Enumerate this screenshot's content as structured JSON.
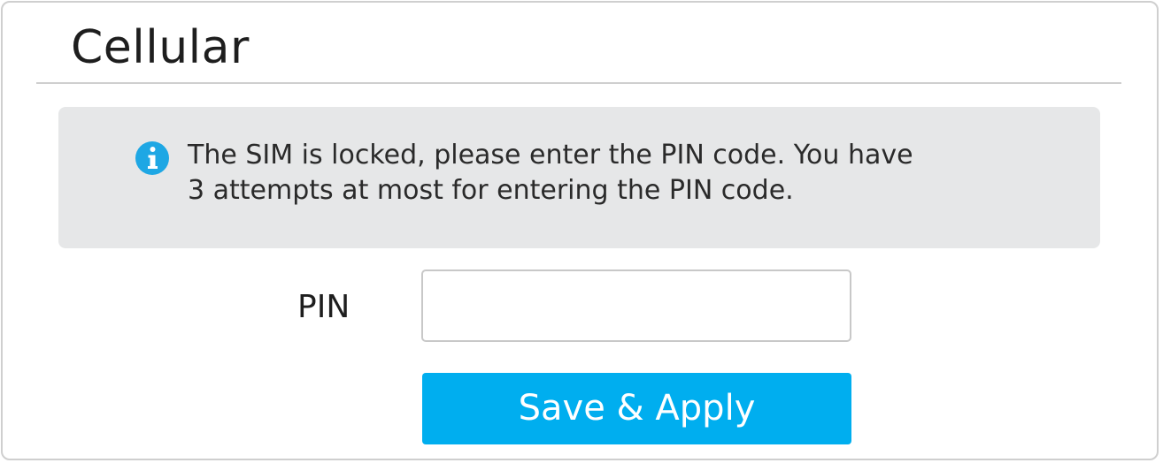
{
  "section": {
    "title": "Cellular"
  },
  "notice": {
    "icon": "info-icon",
    "icon_color": "#1ea7e4",
    "lines": [
      "The SIM is locked, please enter the PIN code. You have",
      "3 attempts at most for entering the PIN code."
    ]
  },
  "form": {
    "pin_label": "PIN",
    "pin_value": "",
    "save_label": "Save & Apply",
    "button_color": "#00aeef"
  }
}
